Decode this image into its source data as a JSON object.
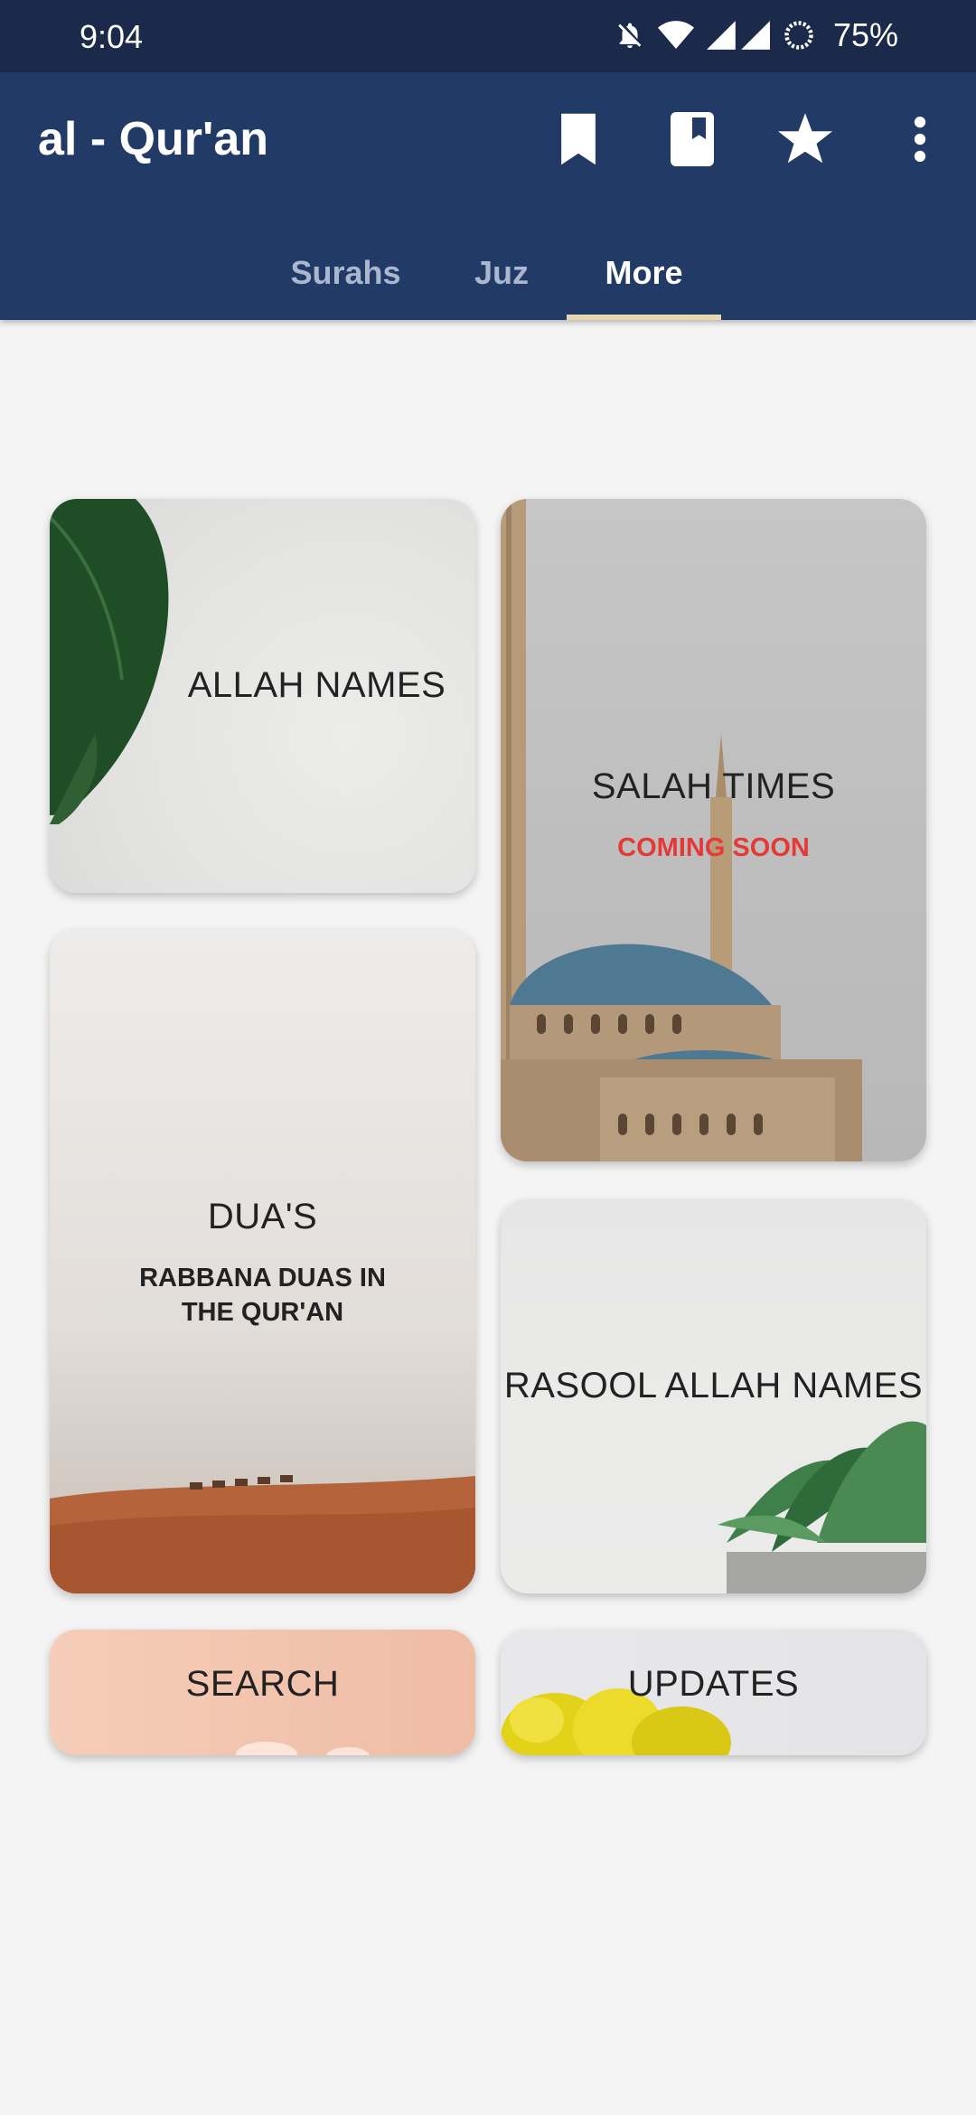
{
  "status_bar": {
    "time": "9:04",
    "battery": "75%",
    "icons": [
      "bell-off-icon",
      "wifi-icon",
      "signal-icon",
      "battery-icon"
    ]
  },
  "app_bar": {
    "title": "al - Qur'an",
    "actions": [
      "bookmark-icon",
      "book-icon",
      "star-icon",
      "more-vert-icon"
    ]
  },
  "tabs": [
    {
      "label": "Surahs",
      "active": false
    },
    {
      "label": "Juz",
      "active": false
    },
    {
      "label": "More",
      "active": true
    }
  ],
  "cards": {
    "allah_names": {
      "title": "ALLAH NAMES"
    },
    "salah_times": {
      "title": "SALAH TIMES",
      "subtitle": "COMING SOON"
    },
    "duas": {
      "title": "DUA'S",
      "subtitle_line1": "RABBANA DUAS IN",
      "subtitle_line2": "THE QUR'AN"
    },
    "rasool_names": {
      "title": "RASOOL ALLAH NAMES"
    },
    "search": {
      "title": "SEARCH"
    },
    "updates": {
      "title": "UPDATES"
    }
  },
  "colors": {
    "status_bar": "#1b2a4a",
    "app_bar": "#213a66",
    "tab_indicator": "#e8d8b0",
    "coming_soon": "#e53935"
  }
}
